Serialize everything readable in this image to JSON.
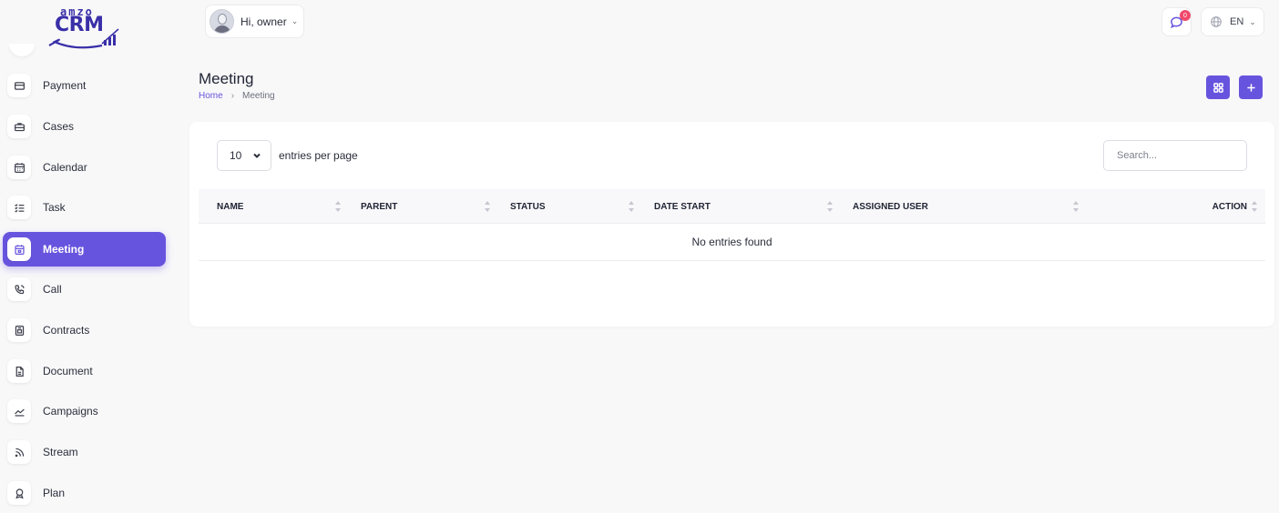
{
  "logo": {
    "top_text": "amzo",
    "main_text": "CRM"
  },
  "brand_colors": {
    "accent": "#6754de",
    "badge": "#f04a6b"
  },
  "sidebar": {
    "items": [
      {
        "label": "Payment",
        "icon": "credit-card-icon"
      },
      {
        "label": "Cases",
        "icon": "briefcase-icon"
      },
      {
        "label": "Calendar",
        "icon": "calendar-icon"
      },
      {
        "label": "Task",
        "icon": "checklist-icon"
      },
      {
        "label": "Meeting",
        "icon": "calendar-event-icon",
        "active": true
      },
      {
        "label": "Call",
        "icon": "phone-icon"
      },
      {
        "label": "Contracts",
        "icon": "contract-icon"
      },
      {
        "label": "Document",
        "icon": "document-icon"
      },
      {
        "label": "Campaigns",
        "icon": "trend-icon"
      },
      {
        "label": "Stream",
        "icon": "rss-icon"
      },
      {
        "label": "Plan",
        "icon": "award-icon"
      }
    ]
  },
  "header": {
    "user_greeting": "Hi, owner",
    "notification_count": "0",
    "language": "EN"
  },
  "page": {
    "title": "Meeting",
    "breadcrumb": {
      "home": "Home",
      "current": "Meeting"
    }
  },
  "table": {
    "entries_per_page": "10",
    "entries_label": "entries per page",
    "search_placeholder": "Search...",
    "columns": [
      "NAME",
      "PARENT",
      "STATUS",
      "DATE START",
      "ASSIGNED USER",
      "ACTION"
    ],
    "empty_message": "No entries found"
  }
}
